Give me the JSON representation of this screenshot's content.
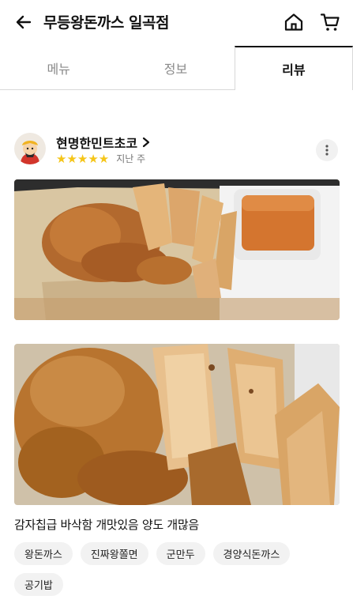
{
  "header": {
    "title": "무등왕돈까스 일곡점"
  },
  "tabs": [
    {
      "label": "메뉴",
      "active": false
    },
    {
      "label": "정보",
      "active": false
    },
    {
      "label": "리뷰",
      "active": true
    }
  ],
  "review": {
    "author": "현명한민트초코",
    "rating": 5,
    "stars_text": "★★★★★",
    "date": "지난 주",
    "text": "감자칩급 바삭함 개맛있음 양도 개많음",
    "tags": [
      "왕돈까스",
      "진짜왕쫄면",
      "군만두",
      "경양식돈까스",
      "공기밥"
    ]
  },
  "colors": {
    "star": "#f5c518",
    "tag_bg": "#f2f2f2",
    "active_tab": "#111111",
    "inactive_tab": "#8a8a8a"
  },
  "icons": {
    "back": "arrow-left-icon",
    "home": "home-icon",
    "cart": "cart-icon",
    "more": "more-vertical-icon"
  }
}
